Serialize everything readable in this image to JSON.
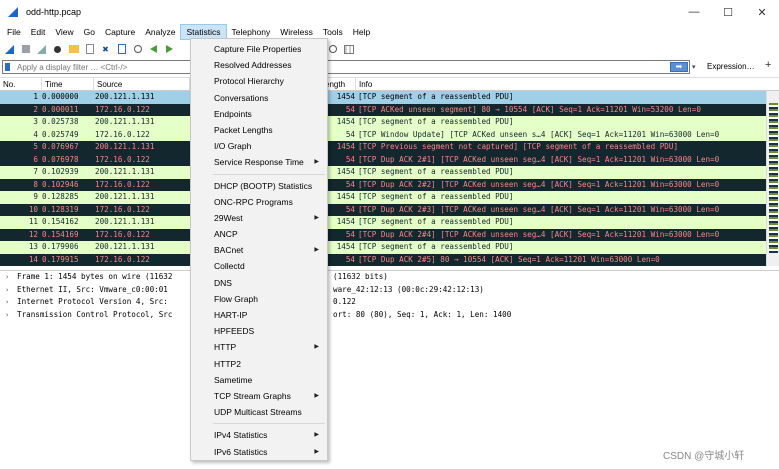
{
  "window": {
    "title": "odd-http.pcap",
    "controls": {
      "minimize": "—",
      "maximize": "☐",
      "close": "✕"
    }
  },
  "menubar": [
    "File",
    "Edit",
    "View",
    "Go",
    "Capture",
    "Analyze",
    "Statistics",
    "Telephony",
    "Wireless",
    "Tools",
    "Help"
  ],
  "filter": {
    "placeholder": "Apply a display filter … <Ctrl-/>",
    "apply_label": "➡",
    "dropdown_label": "▾",
    "expression_label": "Expression…",
    "plus_label": "+"
  },
  "packet_list": {
    "columns": [
      "No.",
      "Time",
      "Source",
      "",
      "ength",
      "Info"
    ],
    "rows": [
      {
        "no": "1",
        "time": "0.000000",
        "src": "200.121.1.131",
        "len": "1454",
        "info": "[TCP segment of a reassembled PDU]",
        "style": "sel"
      },
      {
        "no": "2",
        "time": "0.000011",
        "src": "172.16.0.122",
        "len": "54",
        "info": "[TCP ACKed unseen segment] 80 → 10554 [ACK] Seq=1 Ack=11201 Win=53200 Len=0",
        "style": "dark"
      },
      {
        "no": "3",
        "time": "0.025738",
        "src": "200.121.1.131",
        "len": "1454",
        "info": "[TCP segment of a reassembled PDU]",
        "style": "green"
      },
      {
        "no": "4",
        "time": "0.025749",
        "src": "172.16.0.122",
        "len": "54",
        "info": "[TCP Window Update] [TCP ACKed unseen s…4 [ACK] Seq=1 Ack=11201 Win=63000 Len=0",
        "style": "green"
      },
      {
        "no": "5",
        "time": "0.076967",
        "src": "200.121.1.131",
        "len": "1454",
        "info": "[TCP Previous segment not captured] [TCP segment of a reassembled PDU]",
        "style": "dark"
      },
      {
        "no": "6",
        "time": "0.076978",
        "src": "172.16.0.122",
        "len": "54",
        "info": "[TCP Dup ACK 2#1] [TCP ACKed unseen seg…4 [ACK] Seq=1 Ack=11201 Win=63000 Len=0",
        "style": "dark"
      },
      {
        "no": "7",
        "time": "0.102939",
        "src": "200.121.1.131",
        "len": "1454",
        "info": "[TCP segment of a reassembled PDU]",
        "style": "green"
      },
      {
        "no": "8",
        "time": "0.102946",
        "src": "172.16.0.122",
        "len": "54",
        "info": "[TCP Dup ACK 2#2] [TCP ACKed unseen seg…4 [ACK] Seq=1 Ack=11201 Win=63000 Len=0",
        "style": "dark"
      },
      {
        "no": "9",
        "time": "0.128285",
        "src": "200.121.1.131",
        "len": "1454",
        "info": "[TCP segment of a reassembled PDU]",
        "style": "green"
      },
      {
        "no": "10",
        "time": "0.128319",
        "src": "172.16.0.122",
        "len": "54",
        "info": "[TCP Dup ACK 2#3] [TCP ACKed unseen seg…4 [ACK] Seq=1 Ack=11201 Win=63000 Len=0",
        "style": "dark"
      },
      {
        "no": "11",
        "time": "0.154162",
        "src": "200.121.1.131",
        "len": "1454",
        "info": "[TCP segment of a reassembled PDU]",
        "style": "green"
      },
      {
        "no": "12",
        "time": "0.154169",
        "src": "172.16.0.122",
        "len": "54",
        "info": "[TCP Dup ACK 2#4] [TCP ACKed unseen seg…4 [ACK] Seq=1 Ack=11201 Win=63000 Len=0",
        "style": "dark"
      },
      {
        "no": "13",
        "time": "0.179906",
        "src": "200.121.1.131",
        "len": "1454",
        "info": "[TCP segment of a reassembled PDU]",
        "style": "green"
      },
      {
        "no": "14",
        "time": "0.179915",
        "src": "172.16.0.122",
        "len": "54",
        "info": "[TCP Dup ACK 2#5] 80 → 10554 [ACK] Seq=1 Ack=11201 Win=63000 Len=0",
        "style": "dark"
      }
    ]
  },
  "details": [
    {
      "left": "Frame 1: 1454 bytes on wire (11632",
      "right": "(11632 bits)"
    },
    {
      "left": "Ethernet II, Src: Vmware_c0:00:01",
      "right": "ware_42:12:13 (00:0c:29:42:12:13)"
    },
    {
      "left": "Internet Protocol Version 4, Src:",
      "right": "0.122"
    },
    {
      "left": "Transmission Control Protocol, Src",
      "right": "ort: 80 (80), Seq: 1, Ack: 1, Len: 1400"
    }
  ],
  "statistics_menu": {
    "items": [
      {
        "label": "Capture File Properties",
        "sub": false
      },
      {
        "label": "Resolved Addresses",
        "sub": false
      },
      {
        "label": "Protocol Hierarchy",
        "sub": false
      },
      {
        "label": "Conversations",
        "sub": false
      },
      {
        "label": "Endpoints",
        "sub": false
      },
      {
        "label": "Packet Lengths",
        "sub": false
      },
      {
        "label": "I/O Graph",
        "sub": false
      },
      {
        "label": "Service Response Time",
        "sub": true
      },
      {
        "separator": true
      },
      {
        "label": "DHCP (BOOTP) Statistics",
        "sub": false
      },
      {
        "label": "ONC-RPC Programs",
        "sub": false
      },
      {
        "label": "29West",
        "sub": true
      },
      {
        "label": "ANCP",
        "sub": false
      },
      {
        "label": "BACnet",
        "sub": true
      },
      {
        "label": "Collectd",
        "sub": false
      },
      {
        "label": "DNS",
        "sub": false
      },
      {
        "label": "Flow Graph",
        "sub": false
      },
      {
        "label": "HART-IP",
        "sub": false
      },
      {
        "label": "HPFEEDS",
        "sub": false
      },
      {
        "label": "HTTP",
        "sub": true
      },
      {
        "label": "HTTP2",
        "sub": false
      },
      {
        "label": "Sametime",
        "sub": false
      },
      {
        "label": "TCP Stream Graphs",
        "sub": true
      },
      {
        "label": "UDP Multicast Streams",
        "sub": false
      },
      {
        "separator": true
      },
      {
        "label": "IPv4 Statistics",
        "sub": true
      },
      {
        "label": "IPv6 Statistics",
        "sub": true
      }
    ],
    "submenu_arrow": "▶"
  },
  "watermark": "CSDN @守城小轩"
}
